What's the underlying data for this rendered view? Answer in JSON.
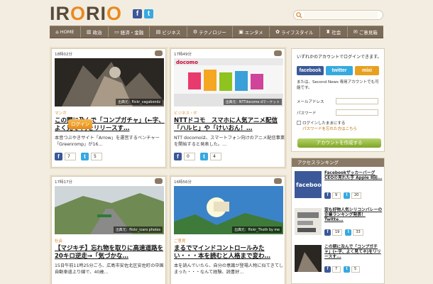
{
  "brand": {
    "logo_pre": "IR",
    "logo_o1": "O",
    "logo_mid": "RI",
    "logo_o2": "O"
  },
  "search": {
    "placeholder": ""
  },
  "nav": [
    "HOME",
    "政治",
    "経済・金融",
    "ビジネス",
    "テクノロジー",
    "エンタメ",
    "ライフスタイル",
    "社会",
    "ご意見箱"
  ],
  "articles": [
    {
      "time": "18時02分",
      "comments": "",
      "category": "マンガ",
      "title": "この闇に及んで「コンプガチャ」(←字、よく見てネ)をリリースす…",
      "excerpt": "本音つぶやきサイト「Arrow」を運営するベンチャー「Greenromp」が16…",
      "credit": "出典元：flickr_vagabondz",
      "fb": "7",
      "tw": "5"
    },
    {
      "time": "17時49分",
      "comments": "",
      "category": "ビジネス・IT",
      "title": "NTTドコモ　スマホに人気アニメ配信「ハルヒ」や「けいおん！…",
      "excerpt": "NTT docomoは、スマートフォン向けのアニメ配信事業を開始すると発表した。…",
      "credit": "出典元：NTTdocomo dマーケット",
      "fb": "0",
      "tw": "4"
    },
    {
      "time": "17時17分",
      "comments": "",
      "category": "社会",
      "title": "【マジキチ】忘れ物を取りに高速道路を20キロ逆走→「気づかな…",
      "excerpt": "15日午前11時25分ごろ、広島市安佐北区安佐町の中国自動車道上り線で、40歳…",
      "credit": "出典元：flickr_icarо photos",
      "fb": "",
      "tw": ""
    },
    {
      "time": "16時56分",
      "comments": "",
      "category": "ご意見",
      "title": "まるでマインドコントロールみたい・・・本を読むと人格まで変わ…",
      "excerpt": "本を読んでいたら、自分の意識が登場人物に似てきてしまった・・・なんて経験、読書好…",
      "credit": "出典元：flickr_Thoth by me",
      "fb": "",
      "tw": ""
    }
  ],
  "login": {
    "title": "いずれかのアカウントでログインできます。",
    "facebook": "facebook",
    "twitter": "twitter",
    "mixi": "mixi",
    "or": "または、Second News 専用アカウントでも可能です。",
    "email_label": "メールアドレス",
    "password_label": "パスワード",
    "remember": "ログインしたままにする",
    "forgot": "パスワードを忘れた方はこちら",
    "login_btn": "ログイン",
    "create_btn": "アカウントを作成する"
  },
  "ranking": {
    "title": "アクセスランキング",
    "items": [
      {
        "title": "Facebookザッカーバーグ CEOの見れた手 Apple 8回...",
        "fb": "9",
        "tw": "20"
      },
      {
        "title": "窓も好物人気シリコンバレーの企業ランキング発表！ Twitte...",
        "fb": "19",
        "tw": "33"
      },
      {
        "title": "この期に及んで「コンプガチャ」(←字、よく見てネ)をリリースす...",
        "fb": "7",
        "tw": "5"
      }
    ]
  }
}
